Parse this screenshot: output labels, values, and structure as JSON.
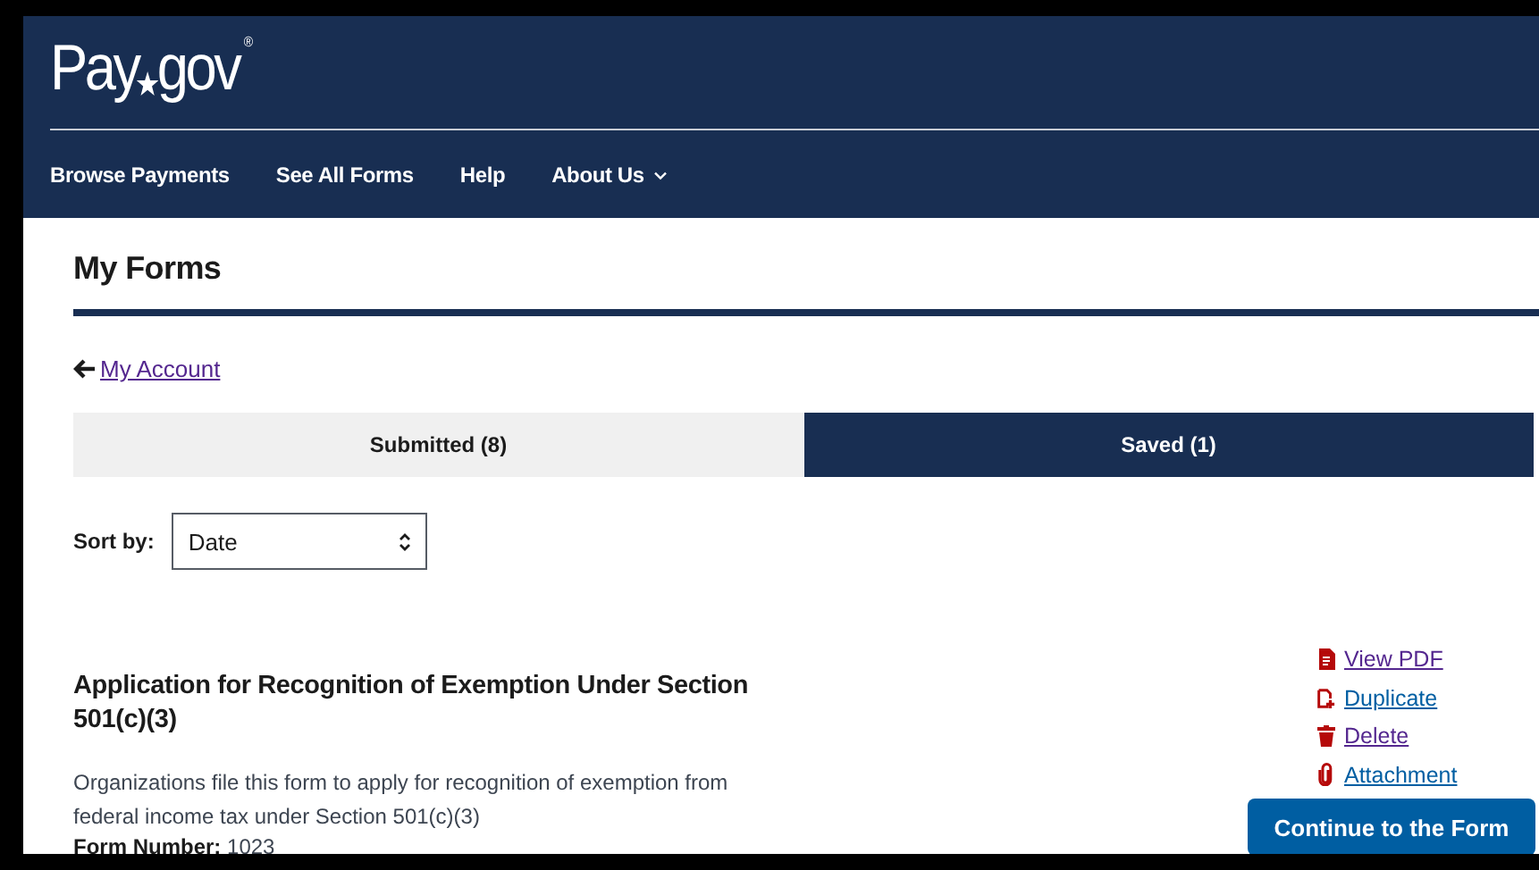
{
  "logo": {
    "before": "Pay",
    "after": "gov",
    "mark": "®"
  },
  "nav": [
    {
      "label": "Browse Payments",
      "has_menu": false
    },
    {
      "label": "See All Forms",
      "has_menu": false
    },
    {
      "label": "Help",
      "has_menu": false
    },
    {
      "label": "About Us",
      "has_menu": true
    }
  ],
  "page_title": "My Forms",
  "back_link": {
    "label": "My Account",
    "visited": true
  },
  "tabs": [
    {
      "label": "Submitted (8)",
      "selected": false
    },
    {
      "label": "Saved (1)",
      "selected": true
    }
  ],
  "sort": {
    "label": "Sort by:",
    "value": "Date"
  },
  "form": {
    "title": "Application for Recognition of Exemption Under Section 501(c)(3)",
    "description": "Organizations file this form to apply for recognition of exemption from federal income tax under Section 501(c)(3)",
    "number_label": "Form Number:",
    "number": "1023",
    "actions": [
      {
        "kind": "pdf",
        "label": "View PDF",
        "visited": true
      },
      {
        "kind": "duplicate",
        "label": "Duplicate",
        "visited": false
      },
      {
        "kind": "delete",
        "label": "Delete",
        "visited": true
      },
      {
        "kind": "attachment",
        "label": "Attachment",
        "visited": false
      }
    ],
    "primary_button": "Continue to the Form"
  }
}
